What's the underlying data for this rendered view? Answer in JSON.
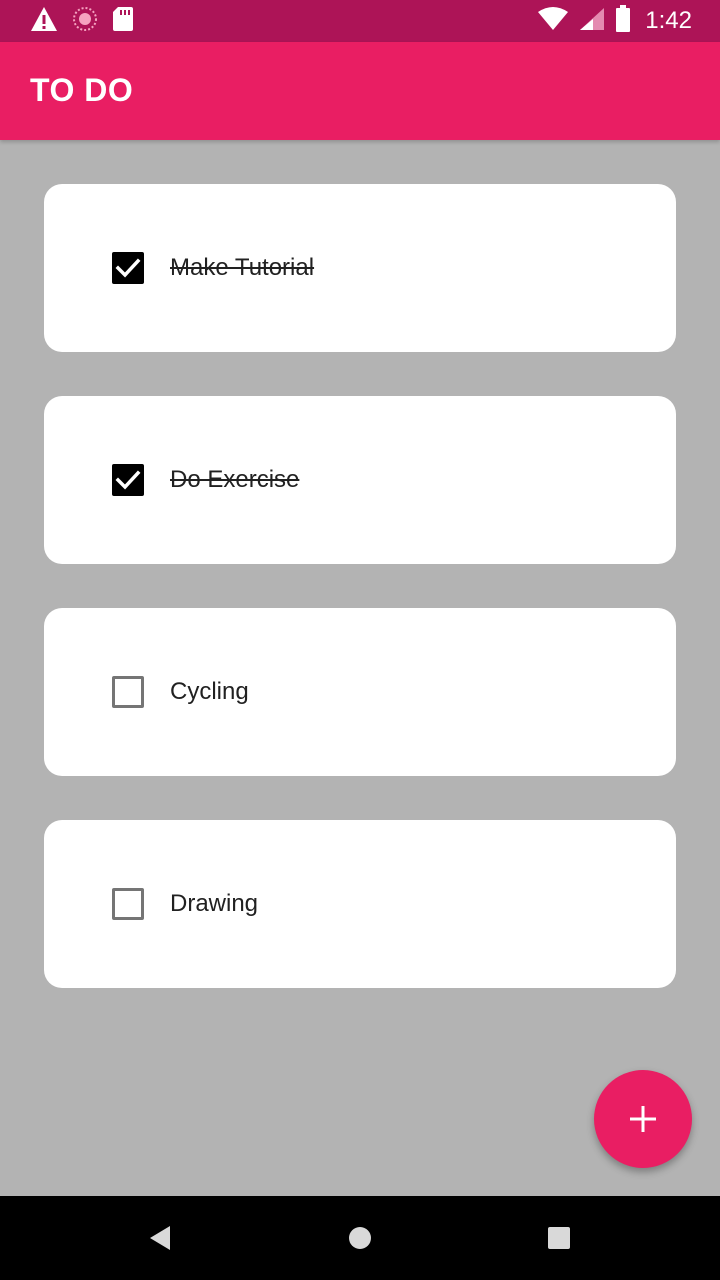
{
  "status_bar": {
    "time": "1:42",
    "left_icons": [
      "warning-icon",
      "sync-icon",
      "sd-card-icon"
    ],
    "right_icons": [
      "wifi-icon",
      "signal-icon",
      "battery-icon"
    ],
    "color": "#ad1457"
  },
  "app_bar": {
    "title": "TO DO",
    "color": "#e91e63"
  },
  "todos": [
    {
      "label": "Make Tutorial",
      "done": true
    },
    {
      "label": "Do Exercise",
      "done": true
    },
    {
      "label": "Cycling",
      "done": false
    },
    {
      "label": "Drawing",
      "done": false
    }
  ],
  "fab": {
    "icon": "plus-icon",
    "color": "#e91e63"
  },
  "nav_bar": {
    "buttons": [
      "back-icon",
      "home-icon",
      "recents-icon"
    ]
  }
}
